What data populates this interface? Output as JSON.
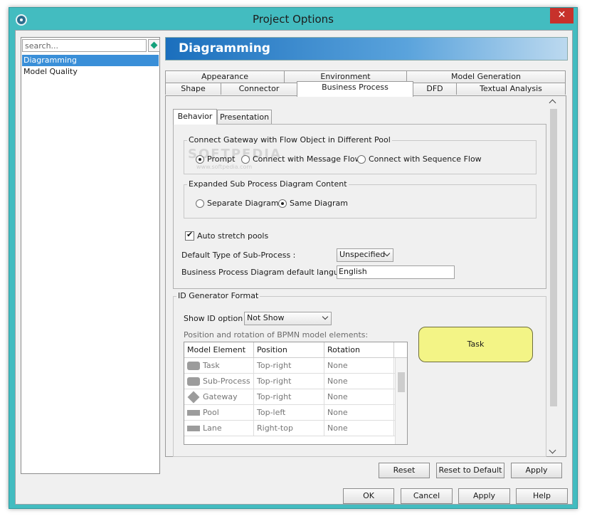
{
  "window": {
    "title": "Project Options",
    "close": "✕"
  },
  "left": {
    "search_placeholder": "search...",
    "tree": [
      "Diagramming",
      "Model Quality"
    ]
  },
  "header": {
    "title": "Diagramming"
  },
  "tabs_row1": [
    "Appearance",
    "Environment",
    "Model Generation"
  ],
  "tabs_row2": [
    "Shape",
    "Connector",
    "Business Process",
    "DFD",
    "Textual Analysis"
  ],
  "subtabs": [
    "Behavior",
    "Presentation"
  ],
  "watermark": {
    "text": "SOFTPEDIA",
    "sub": "www.softpedia.com"
  },
  "gateway": {
    "title": "Connect Gateway with Flow Object in Different Pool",
    "options": [
      "Prompt",
      "Connect with Message Flow",
      "Connect with Sequence Flow"
    ],
    "selected": "Prompt"
  },
  "subprocess": {
    "title": "Expanded Sub Process Diagram Content",
    "options": [
      "Separate Diagram",
      "Same Diagram"
    ],
    "selected": "Same Diagram"
  },
  "auto_stretch": {
    "label": "Auto stretch pools",
    "checked": true
  },
  "default_type": {
    "label": "Default Type of Sub-Process :",
    "value": "Unspecified"
  },
  "language": {
    "label": "Business Process Diagram default language :",
    "value": "English"
  },
  "id_generator": {
    "title": "ID Generator Format",
    "show_label": "Show ID option :",
    "show_value": "Not Show",
    "position_label": "Position and rotation of BPMN model elements:",
    "columns": [
      "Model Element",
      "Position",
      "Rotation"
    ],
    "rows": [
      {
        "element": "Task",
        "position": "Top-right",
        "rotation": "None",
        "icon": "task-icon"
      },
      {
        "element": "Sub-Process",
        "position": "Top-right",
        "rotation": "None",
        "icon": "subprocess-icon"
      },
      {
        "element": "Gateway",
        "position": "Top-right",
        "rotation": "None",
        "icon": "gateway-icon"
      },
      {
        "element": "Pool",
        "position": "Top-left",
        "rotation": "None",
        "icon": "pool-icon"
      },
      {
        "element": "Lane",
        "position": "Right-top",
        "rotation": "None",
        "icon": "lane-icon"
      }
    ],
    "preview": "Task"
  },
  "buttons_inner": [
    "Reset",
    "Reset to Default",
    "Apply"
  ],
  "buttons_outer": [
    "OK",
    "Cancel",
    "Apply",
    "Help"
  ]
}
